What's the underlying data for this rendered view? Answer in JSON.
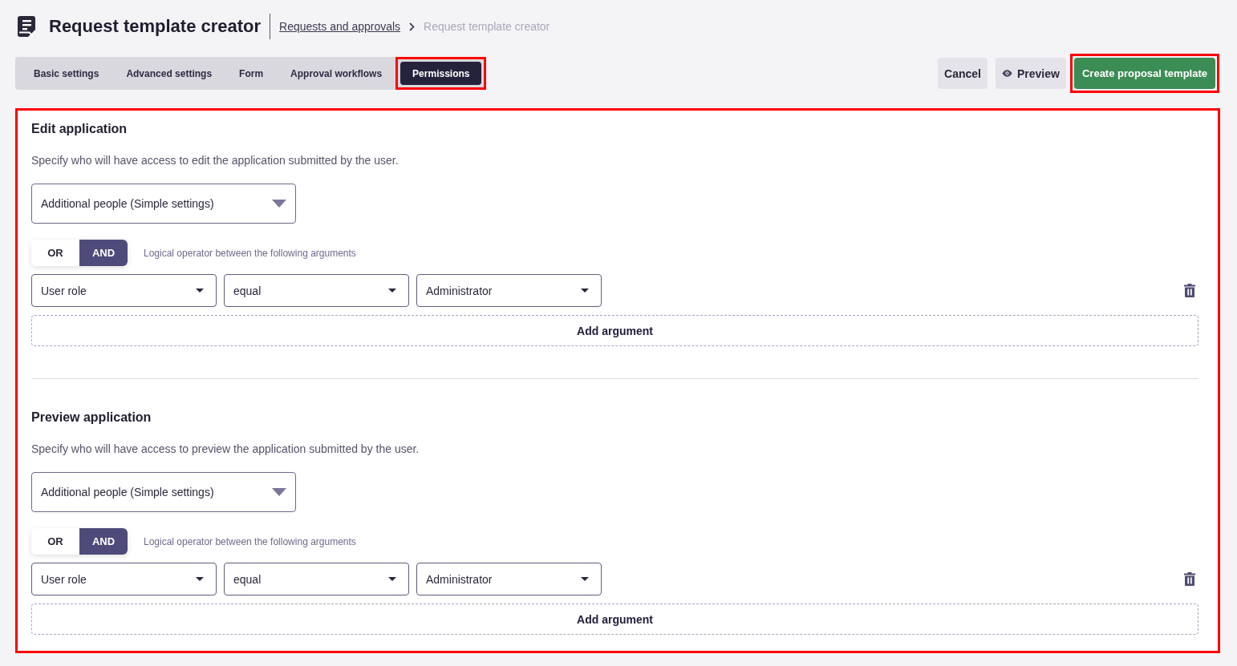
{
  "header": {
    "title": "Request template creator",
    "breadcrumb": [
      {
        "label": "Requests and approvals",
        "kind": "link"
      },
      {
        "label": "Request template creator",
        "kind": "current"
      }
    ]
  },
  "tabs": [
    {
      "label": "Basic settings",
      "selected": false,
      "highlighted": false
    },
    {
      "label": "Advanced settings",
      "selected": false,
      "highlighted": false
    },
    {
      "label": "Form",
      "selected": false,
      "highlighted": false
    },
    {
      "label": "Approval workflows",
      "selected": false,
      "highlighted": false
    },
    {
      "label": "Permissions",
      "selected": true,
      "highlighted": true
    }
  ],
  "actions": [
    {
      "label": "Cancel",
      "kind": "secondary",
      "highlighted": false
    },
    {
      "label": "Preview",
      "kind": "preview",
      "highlighted": false
    },
    {
      "label": "Create proposal template",
      "kind": "primary",
      "highlighted": true
    }
  ],
  "panel": {
    "highlighted": true,
    "sections": [
      {
        "title": "Edit application",
        "description": "Specify who will have access to edit the application submitted by the user.",
        "access_select": "Additional people (Simple settings)",
        "operator": {
          "options": [
            {
              "label": "OR",
              "selected": false
            },
            {
              "label": "AND",
              "selected": true
            }
          ],
          "hint": "Logical operator between the following arguments"
        },
        "arguments": [
          {
            "field": "User role",
            "comparison": "equal",
            "value": "Administrator"
          }
        ],
        "add_button": "Add argument"
      },
      {
        "title": "Preview application",
        "description": "Specify who will have access to preview the application submitted by the user.",
        "access_select": "Additional people (Simple settings)",
        "operator": {
          "options": [
            {
              "label": "OR",
              "selected": false
            },
            {
              "label": "AND",
              "selected": true
            }
          ],
          "hint": "Logical operator between the following arguments"
        },
        "arguments": [
          {
            "field": "User role",
            "comparison": "equal",
            "value": "Administrator"
          }
        ],
        "add_button": "Add argument"
      }
    ]
  }
}
